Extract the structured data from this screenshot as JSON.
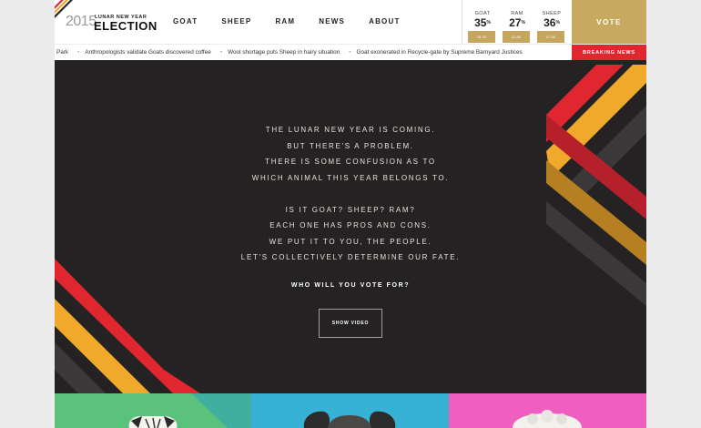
{
  "logo": {
    "year": "2015",
    "subtitle": "LUNAR NEW YEAR",
    "title": "ELECTION"
  },
  "nav": [
    "GOAT",
    "SHEEP",
    "RAM",
    "NEWS",
    "ABOUT"
  ],
  "scores": [
    {
      "label": "GOAT",
      "value": "35",
      "unit": "%",
      "votes": "16.7K"
    },
    {
      "label": "RAM",
      "value": "27",
      "unit": "%",
      "votes": "12.8K"
    },
    {
      "label": "SHEEP",
      "value": "36",
      "unit": "%",
      "votes": "17.2K"
    }
  ],
  "vote_label": "VOTE",
  "ticker": {
    "items": [
      "Park",
      "Anthropologists validate Goats discovered coffee",
      "Wool shortage puts Sheep in hairy situation",
      "Goat exonerated in Recycle-gate by Supreme Barnyard Justices"
    ],
    "breaking_label": "BREAKING NEWS"
  },
  "hero": {
    "paragraph1": [
      "THE LUNAR NEW YEAR IS COMING.",
      "BUT THERE'S A PROBLEM.",
      "THERE IS SOME CONFUSION AS TO",
      "WHICH ANIMAL THIS YEAR BELONGS TO."
    ],
    "paragraph2": [
      "IS IT GOAT? SHEEP? RAM?",
      "EACH ONE HAS PROS AND CONS.",
      "WE PUT IT TO YOU, THE PEOPLE.",
      "LET'S COLLECTIVELY DETERMINE OUR FATE."
    ],
    "question": "WHO WILL YOU VOTE FOR?",
    "button_label": "SHOW VIDEO"
  },
  "colors": {
    "gold": "#c7a95f",
    "red": "#e0262e",
    "orange": "#f0a92a",
    "hero_bg": "#242223",
    "goat_tile": "#5ac27b",
    "ram_tile": "#37b1d4",
    "sheep_tile": "#ef5fbf"
  }
}
